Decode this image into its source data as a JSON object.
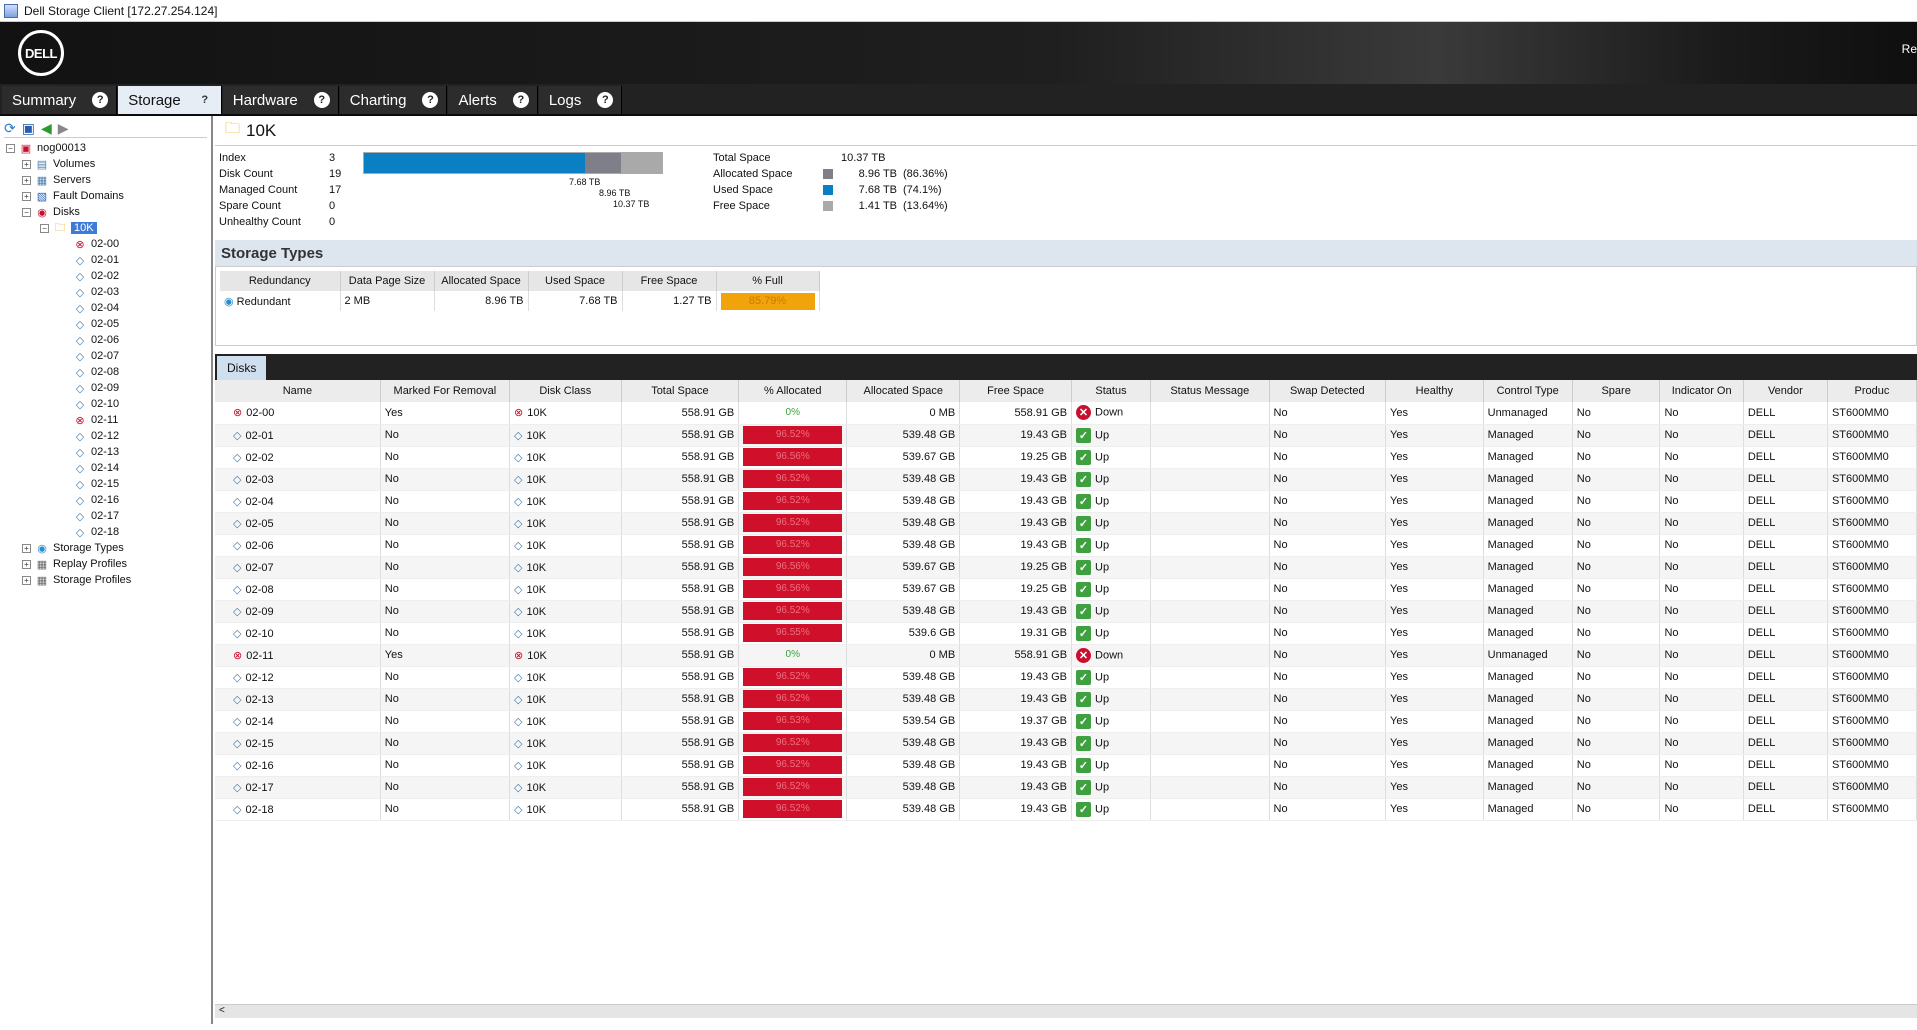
{
  "window": {
    "title": "Dell Storage Client [172.27.254.124]"
  },
  "banner": {
    "logo": "DELL",
    "right_text": "Re"
  },
  "nav": {
    "tabs": [
      {
        "label": "Summary",
        "help": "?"
      },
      {
        "label": "Storage",
        "help": "?"
      },
      {
        "label": "Hardware",
        "help": "?"
      },
      {
        "label": "Charting",
        "help": "?"
      },
      {
        "label": "Alerts",
        "help": "?"
      },
      {
        "label": "Logs",
        "help": "?"
      }
    ],
    "active": "Storage"
  },
  "toolbar_icons": [
    "refresh-icon",
    "save-icon",
    "back-icon",
    "forward-icon"
  ],
  "tree": {
    "root": "nog00013",
    "items": [
      "Volumes",
      "Servers",
      "Fault Domains",
      "Disks"
    ],
    "selected_folder": "10K",
    "disks": [
      "02-00",
      "02-01",
      "02-02",
      "02-03",
      "02-04",
      "02-05",
      "02-06",
      "02-07",
      "02-08",
      "02-09",
      "02-10",
      "02-11",
      "02-12",
      "02-13",
      "02-14",
      "02-15",
      "02-16",
      "02-17",
      "02-18"
    ],
    "bottom_items": [
      "Storage Types",
      "Replay Profiles",
      "Storage Profiles"
    ]
  },
  "folder": {
    "title": "10K",
    "stats": [
      {
        "key": "Index",
        "value": "3"
      },
      {
        "key": "Disk Count",
        "value": "19"
      },
      {
        "key": "Managed Count",
        "value": "17"
      },
      {
        "key": "Spare Count",
        "value": "0"
      },
      {
        "key": "Unhealthy Count",
        "value": "0"
      }
    ],
    "bar_labels": {
      "used": "7.68 TB",
      "allocated": "8.96 TB",
      "total": "10.37 TB"
    },
    "space": {
      "total_label": "Total Space",
      "total_value": "10.37 TB",
      "allocated_label": "Allocated Space",
      "allocated_value": "8.96 TB",
      "allocated_pct": "(86.36%)",
      "used_label": "Used Space",
      "used_value": "7.68 TB",
      "used_pct": "(74.1%)",
      "free_label": "Free Space",
      "free_value": "1.41 TB",
      "free_pct": "(13.64%)"
    },
    "used_fraction": 0.741,
    "allocated_fraction": 0.8636
  },
  "colors": {
    "used": "#0a7fc4",
    "allocated": "#7f7f8a",
    "free": "#a9a9a9",
    "alloc_bar": "#d0102b",
    "pct_full": "#f0a30a"
  },
  "storage_types": {
    "title": "Storage Types",
    "headers": [
      "Redundancy",
      "Data Page Size",
      "Allocated Space",
      "Used Space",
      "Free Space",
      "% Full"
    ],
    "row": {
      "redundancy": "Redundant",
      "page": "2 MB",
      "allocated": "8.96 TB",
      "used": "7.68 TB",
      "free": "1.27 TB",
      "full": "85.79%"
    }
  },
  "disks_tab": "Disks",
  "disk_headers": [
    "Name",
    "Marked For Removal",
    "Disk Class",
    "Total Space",
    "% Allocated",
    "Allocated Space",
    "Free Space",
    "Status",
    "Status Message",
    "Swap Detected",
    "Healthy",
    "Control Type",
    "Spare",
    "Indicator On",
    "Vendor",
    "Produc"
  ],
  "disks": [
    {
      "name": "02-00",
      "removal": "Yes",
      "cls": "10K",
      "total": "558.91 GB",
      "pct": "0%",
      "alloc": "0 MB",
      "free": "558.91 GB",
      "status": "Down",
      "swap": "No",
      "healthy": "Yes",
      "control": "Unmanaged",
      "spare": "No",
      "ind": "No",
      "vendor": "DELL",
      "product": "ST600MM0"
    },
    {
      "name": "02-01",
      "removal": "No",
      "cls": "10K",
      "total": "558.91 GB",
      "pct": "96.52%",
      "alloc": "539.48 GB",
      "free": "19.43 GB",
      "status": "Up",
      "swap": "No",
      "healthy": "Yes",
      "control": "Managed",
      "spare": "No",
      "ind": "No",
      "vendor": "DELL",
      "product": "ST600MM0"
    },
    {
      "name": "02-02",
      "removal": "No",
      "cls": "10K",
      "total": "558.91 GB",
      "pct": "96.56%",
      "alloc": "539.67 GB",
      "free": "19.25 GB",
      "status": "Up",
      "swap": "No",
      "healthy": "Yes",
      "control": "Managed",
      "spare": "No",
      "ind": "No",
      "vendor": "DELL",
      "product": "ST600MM0"
    },
    {
      "name": "02-03",
      "removal": "No",
      "cls": "10K",
      "total": "558.91 GB",
      "pct": "96.52%",
      "alloc": "539.48 GB",
      "free": "19.43 GB",
      "status": "Up",
      "swap": "No",
      "healthy": "Yes",
      "control": "Managed",
      "spare": "No",
      "ind": "No",
      "vendor": "DELL",
      "product": "ST600MM0"
    },
    {
      "name": "02-04",
      "removal": "No",
      "cls": "10K",
      "total": "558.91 GB",
      "pct": "96.52%",
      "alloc": "539.48 GB",
      "free": "19.43 GB",
      "status": "Up",
      "swap": "No",
      "healthy": "Yes",
      "control": "Managed",
      "spare": "No",
      "ind": "No",
      "vendor": "DELL",
      "product": "ST600MM0"
    },
    {
      "name": "02-05",
      "removal": "No",
      "cls": "10K",
      "total": "558.91 GB",
      "pct": "96.52%",
      "alloc": "539.48 GB",
      "free": "19.43 GB",
      "status": "Up",
      "swap": "No",
      "healthy": "Yes",
      "control": "Managed",
      "spare": "No",
      "ind": "No",
      "vendor": "DELL",
      "product": "ST600MM0"
    },
    {
      "name": "02-06",
      "removal": "No",
      "cls": "10K",
      "total": "558.91 GB",
      "pct": "96.52%",
      "alloc": "539.48 GB",
      "free": "19.43 GB",
      "status": "Up",
      "swap": "No",
      "healthy": "Yes",
      "control": "Managed",
      "spare": "No",
      "ind": "No",
      "vendor": "DELL",
      "product": "ST600MM0"
    },
    {
      "name": "02-07",
      "removal": "No",
      "cls": "10K",
      "total": "558.91 GB",
      "pct": "96.56%",
      "alloc": "539.67 GB",
      "free": "19.25 GB",
      "status": "Up",
      "swap": "No",
      "healthy": "Yes",
      "control": "Managed",
      "spare": "No",
      "ind": "No",
      "vendor": "DELL",
      "product": "ST600MM0"
    },
    {
      "name": "02-08",
      "removal": "No",
      "cls": "10K",
      "total": "558.91 GB",
      "pct": "96.56%",
      "alloc": "539.67 GB",
      "free": "19.25 GB",
      "status": "Up",
      "swap": "No",
      "healthy": "Yes",
      "control": "Managed",
      "spare": "No",
      "ind": "No",
      "vendor": "DELL",
      "product": "ST600MM0"
    },
    {
      "name": "02-09",
      "removal": "No",
      "cls": "10K",
      "total": "558.91 GB",
      "pct": "96.52%",
      "alloc": "539.48 GB",
      "free": "19.43 GB",
      "status": "Up",
      "swap": "No",
      "healthy": "Yes",
      "control": "Managed",
      "spare": "No",
      "ind": "No",
      "vendor": "DELL",
      "product": "ST600MM0"
    },
    {
      "name": "02-10",
      "removal": "No",
      "cls": "10K",
      "total": "558.91 GB",
      "pct": "96.55%",
      "alloc": "539.6 GB",
      "free": "19.31 GB",
      "status": "Up",
      "swap": "No",
      "healthy": "Yes",
      "control": "Managed",
      "spare": "No",
      "ind": "No",
      "vendor": "DELL",
      "product": "ST600MM0"
    },
    {
      "name": "02-11",
      "removal": "Yes",
      "cls": "10K",
      "total": "558.91 GB",
      "pct": "0%",
      "alloc": "0 MB",
      "free": "558.91 GB",
      "status": "Down",
      "swap": "No",
      "healthy": "Yes",
      "control": "Unmanaged",
      "spare": "No",
      "ind": "No",
      "vendor": "DELL",
      "product": "ST600MM0"
    },
    {
      "name": "02-12",
      "removal": "No",
      "cls": "10K",
      "total": "558.91 GB",
      "pct": "96.52%",
      "alloc": "539.48 GB",
      "free": "19.43 GB",
      "status": "Up",
      "swap": "No",
      "healthy": "Yes",
      "control": "Managed",
      "spare": "No",
      "ind": "No",
      "vendor": "DELL",
      "product": "ST600MM0"
    },
    {
      "name": "02-13",
      "removal": "No",
      "cls": "10K",
      "total": "558.91 GB",
      "pct": "96.52%",
      "alloc": "539.48 GB",
      "free": "19.43 GB",
      "status": "Up",
      "swap": "No",
      "healthy": "Yes",
      "control": "Managed",
      "spare": "No",
      "ind": "No",
      "vendor": "DELL",
      "product": "ST600MM0"
    },
    {
      "name": "02-14",
      "removal": "No",
      "cls": "10K",
      "total": "558.91 GB",
      "pct": "96.53%",
      "alloc": "539.54 GB",
      "free": "19.37 GB",
      "status": "Up",
      "swap": "No",
      "healthy": "Yes",
      "control": "Managed",
      "spare": "No",
      "ind": "No",
      "vendor": "DELL",
      "product": "ST600MM0"
    },
    {
      "name": "02-15",
      "removal": "No",
      "cls": "10K",
      "total": "558.91 GB",
      "pct": "96.52%",
      "alloc": "539.48 GB",
      "free": "19.43 GB",
      "status": "Up",
      "swap": "No",
      "healthy": "Yes",
      "control": "Managed",
      "spare": "No",
      "ind": "No",
      "vendor": "DELL",
      "product": "ST600MM0"
    },
    {
      "name": "02-16",
      "removal": "No",
      "cls": "10K",
      "total": "558.91 GB",
      "pct": "96.52%",
      "alloc": "539.48 GB",
      "free": "19.43 GB",
      "status": "Up",
      "swap": "No",
      "healthy": "Yes",
      "control": "Managed",
      "spare": "No",
      "ind": "No",
      "vendor": "DELL",
      "product": "ST600MM0"
    },
    {
      "name": "02-17",
      "removal": "No",
      "cls": "10K",
      "total": "558.91 GB",
      "pct": "96.52%",
      "alloc": "539.48 GB",
      "free": "19.43 GB",
      "status": "Up",
      "swap": "No",
      "healthy": "Yes",
      "control": "Managed",
      "spare": "No",
      "ind": "No",
      "vendor": "DELL",
      "product": "ST600MM0"
    },
    {
      "name": "02-18",
      "removal": "No",
      "cls": "10K",
      "total": "558.91 GB",
      "pct": "96.52%",
      "alloc": "539.48 GB",
      "free": "19.43 GB",
      "status": "Up",
      "swap": "No",
      "healthy": "Yes",
      "control": "Managed",
      "spare": "No",
      "ind": "No",
      "vendor": "DELL",
      "product": "ST600MM0"
    }
  ]
}
